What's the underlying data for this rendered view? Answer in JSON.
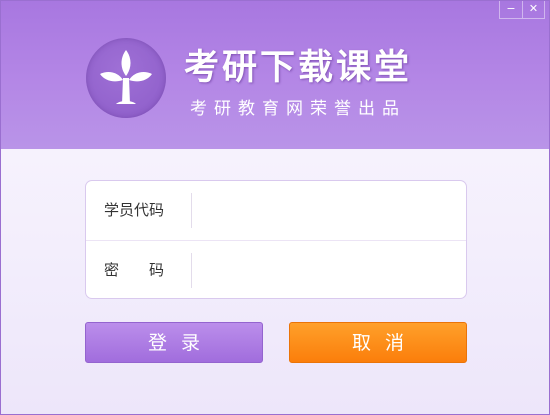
{
  "window": {
    "minimize_symbol": "−",
    "close_symbol": "✕"
  },
  "header": {
    "logo_icon": "sprout-icon",
    "title": "考研下载课堂",
    "subtitle": "考研教育网荣誉出品"
  },
  "form": {
    "student_code_label": "学员代码",
    "student_code_value": "",
    "password_label": "密　　码",
    "password_value": ""
  },
  "buttons": {
    "login_label": "登录",
    "cancel_label": "取消"
  },
  "colors": {
    "header_purple": "#a877e0",
    "login_purple": "#a16ddd",
    "cancel_orange": "#fb7e0b"
  }
}
